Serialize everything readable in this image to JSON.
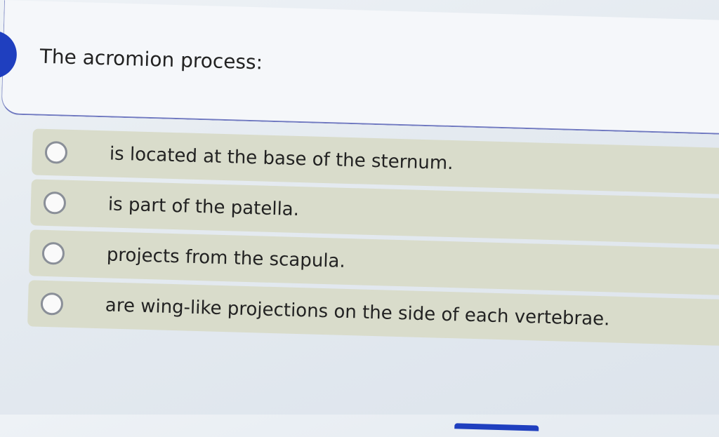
{
  "question": {
    "text": "The acromion process:"
  },
  "choices": [
    {
      "label": "is located at the base of the sternum."
    },
    {
      "label": "is part of the patella."
    },
    {
      "label": "projects from the scapula."
    },
    {
      "label": "are wing-like projections on the side of each vertebrae."
    }
  ],
  "colors": {
    "accent": "#1f3fbf",
    "choice_background": "#d9dccb",
    "card_border": "#6f78c0"
  }
}
